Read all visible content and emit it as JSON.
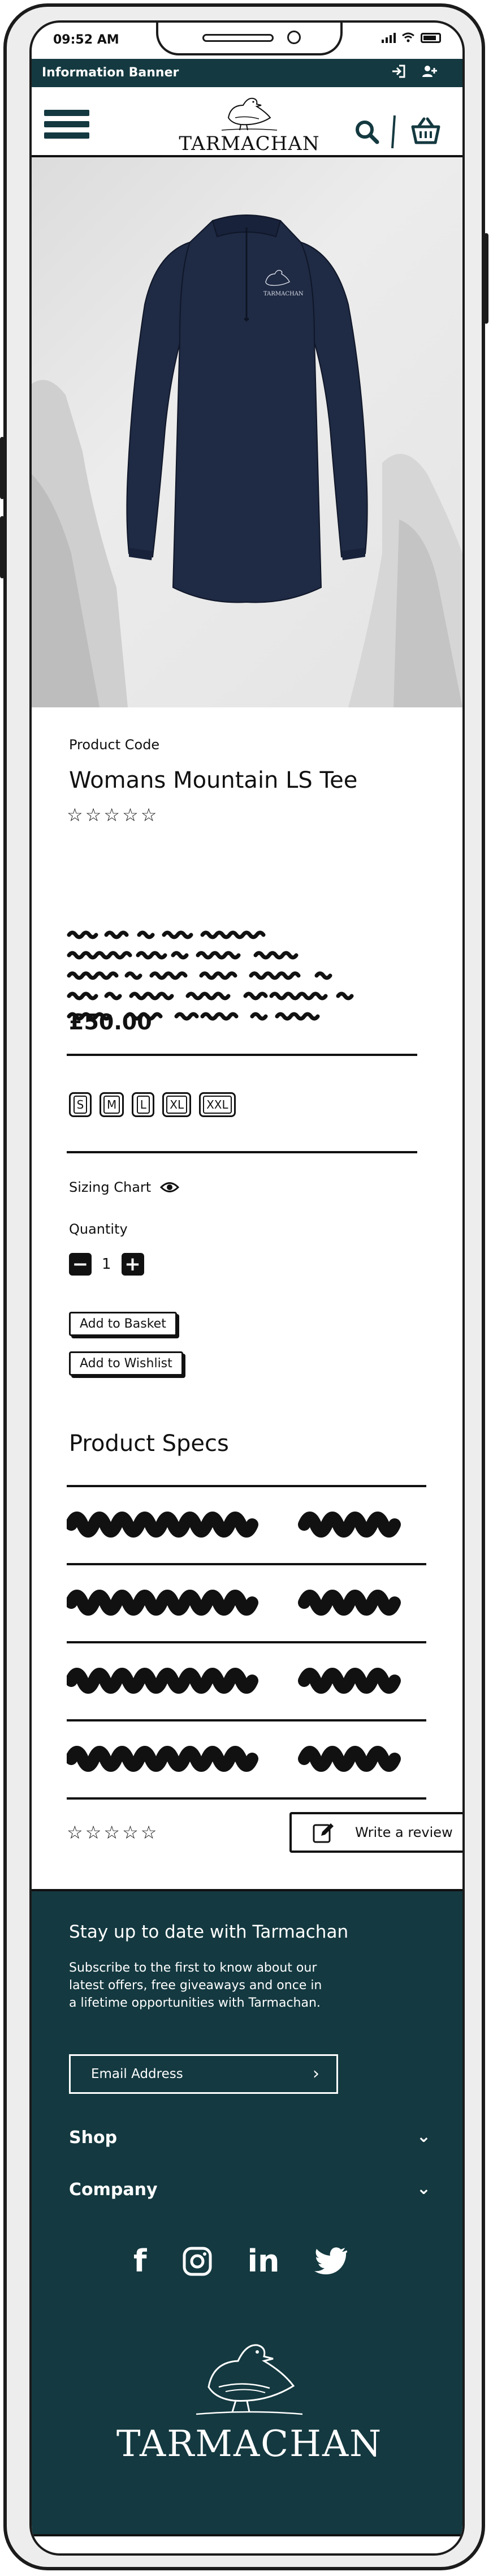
{
  "status_bar": {
    "time": "09:52 AM"
  },
  "banner": {
    "text": "Information Banner",
    "login_icon": "sign-in-icon",
    "account_icon": "add-user-icon"
  },
  "header": {
    "brand": "TARMACHAN",
    "menu_icon": "hamburger-menu-icon",
    "search_icon": "search-icon",
    "cart_icon": "basket-icon"
  },
  "hero": {
    "image": "navy long sleeve half-zip top with ptarmigan logo"
  },
  "product": {
    "code_label": "Product Code",
    "name": "Womans Mountain LS Tee",
    "rating": {
      "value": 0,
      "max": 5
    },
    "price": "£50.00",
    "sizes": [
      "S",
      "M",
      "L",
      "XL",
      "XXL"
    ],
    "sizing_chart_label": "Sizing Chart",
    "quantity_label": "Quantity",
    "quantity": "1",
    "add_to_basket": "Add to Basket",
    "add_to_wishlist": "Add to Wishlist"
  },
  "specs": {
    "title": "Product Specs",
    "rows": 4
  },
  "reviews": {
    "rating": {
      "value": 0,
      "max": 5
    },
    "write_review": "Write a review"
  },
  "footer": {
    "newsletter_title": "Stay up to date with Tarmachan",
    "newsletter_text": "Subscribe to the first to know about our latest offers, free giveaways and once in a lifetime opportunities with Tarmachan.",
    "email_placeholder": "Email Address",
    "accordions": [
      "Shop",
      "Company"
    ],
    "social": [
      {
        "icon": "facebook-icon",
        "glyph": "f"
      },
      {
        "icon": "instagram-icon",
        "glyph": ""
      },
      {
        "icon": "linkedin-icon",
        "glyph": "in"
      },
      {
        "icon": "twitter-icon",
        "glyph": ""
      }
    ],
    "brand": "TARMACHAN"
  },
  "colors": {
    "brand_dark": "#143940",
    "ink": "#111111",
    "page": "#ffffff"
  }
}
